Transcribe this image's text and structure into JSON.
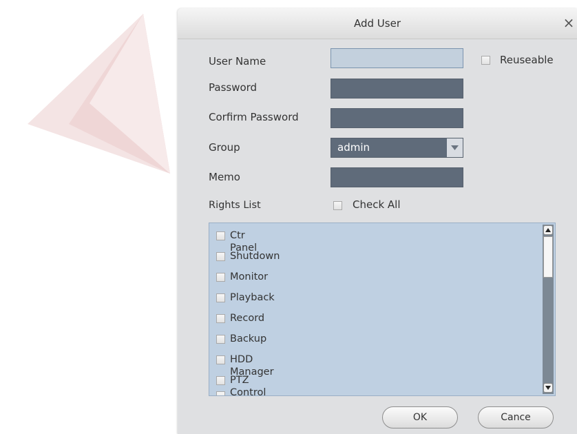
{
  "dialog": {
    "title": "Add User",
    "close_glyph": "×"
  },
  "form": {
    "username_label": "User Name",
    "username_value": "",
    "reuseable_label": "Reuseable",
    "password_label": "Password",
    "password_value": "",
    "confirm_label": "Corfirm Password",
    "confirm_value": "",
    "group_label": "Group",
    "group_value": "admin",
    "memo_label": "Memo",
    "memo_value": "",
    "rights_label": "Rights List",
    "check_all_label": "Check All"
  },
  "rights": [
    {
      "label": "Ctr Panel",
      "checked": false
    },
    {
      "label": "Shutdown",
      "checked": false
    },
    {
      "label": "Monitor",
      "checked": false
    },
    {
      "label": "Playback",
      "checked": false
    },
    {
      "label": "Record",
      "checked": false
    },
    {
      "label": "Backup",
      "checked": false
    },
    {
      "label": "HDD Manager",
      "checked": false
    },
    {
      "label": "PTZ Control",
      "checked": false
    }
  ],
  "buttons": {
    "ok_label": "OK",
    "cancel_label": "Cance"
  },
  "colors": {
    "field_bg": "#5f6b7a",
    "field_active_bg": "#c3d0dd",
    "rights_bg": "#bfd0e2",
    "dialog_bg": "#dfe0e2",
    "logo": "#f3dede"
  },
  "icons": {
    "close": "close-icon",
    "dropdown": "chevron-down-icon",
    "scroll_up": "scroll-up-arrow-icon",
    "scroll_down": "scroll-down-arrow-icon",
    "logo": "brand-logo-watermark"
  }
}
